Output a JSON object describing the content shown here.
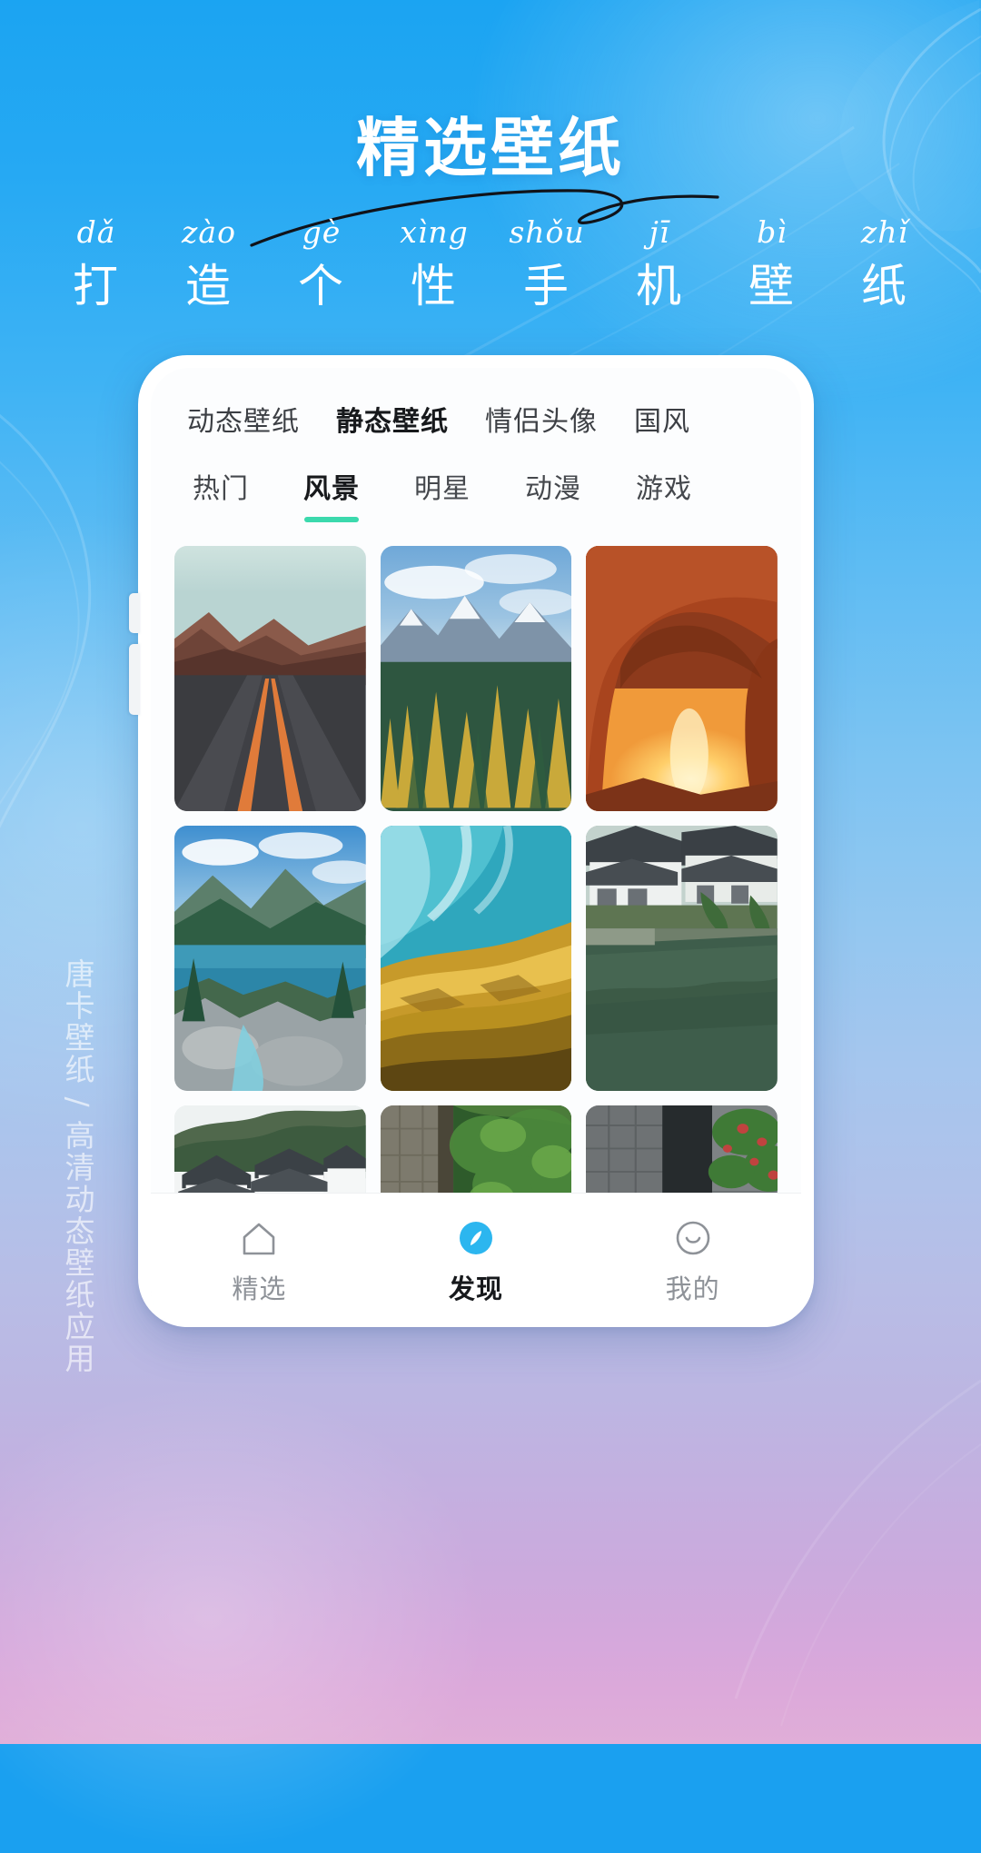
{
  "poster": {
    "title": "精选壁纸",
    "pinyin": [
      "dǎ",
      "zào",
      "gè",
      "xìng",
      "shǒu",
      "jī",
      "bì",
      "zhǐ"
    ],
    "subtitle_chars": [
      "打",
      "造",
      "个",
      "性",
      "手",
      "机",
      "壁",
      "纸"
    ],
    "subtitle_full": "打造个性手机壁纸",
    "side_watermark": "唐卡壁纸 / 高清动态壁纸应用",
    "accent_color": "#3bd9ad",
    "brand_blue": "#1ba4f2",
    "title_color": "#ffffff"
  },
  "app": {
    "main_tabs": [
      {
        "label": "动态壁纸",
        "active": false
      },
      {
        "label": "静态壁纸",
        "active": true
      },
      {
        "label": "情侣头像",
        "active": false
      },
      {
        "label": "国风",
        "active": false
      }
    ],
    "category_tabs": [
      {
        "label": "热门",
        "active": false
      },
      {
        "label": "风景",
        "active": true
      },
      {
        "label": "明星",
        "active": false
      },
      {
        "label": "动漫",
        "active": false
      },
      {
        "label": "游戏",
        "active": false
      }
    ],
    "gallery": [
      {
        "name": "desert-highway",
        "alt": "沙漠公路"
      },
      {
        "name": "snow-mountain-forest",
        "alt": "雪山森林"
      },
      {
        "name": "canyon-arch-sunset",
        "alt": "峡谷石拱日落"
      },
      {
        "name": "alpine-lake",
        "alt": "高山湖泊"
      },
      {
        "name": "turquoise-waterfall",
        "alt": "碧绿瀑布"
      },
      {
        "name": "water-town-canal",
        "alt": "江南水乡"
      },
      {
        "name": "huizhou-village",
        "alt": "徽派村落"
      },
      {
        "name": "stone-alley-green",
        "alt": "石巷绿荫"
      },
      {
        "name": "stone-path-flowers",
        "alt": "石板小路花丛"
      }
    ],
    "bottom_nav": [
      {
        "label": "精选",
        "icon": "home-icon",
        "active": false
      },
      {
        "label": "发现",
        "icon": "compass-icon",
        "active": true
      },
      {
        "label": "我的",
        "icon": "smiley-icon",
        "active": false
      }
    ]
  }
}
